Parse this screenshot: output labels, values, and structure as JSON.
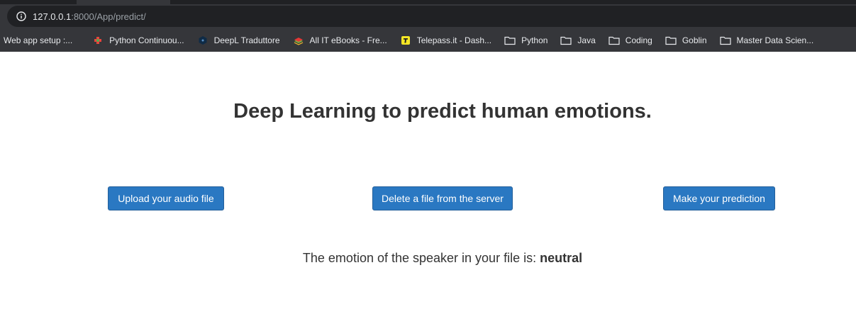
{
  "browser": {
    "url_host": "127.0.0.1",
    "url_rest": ":8000/App/predict/",
    "bookmarks": [
      {
        "label": "Web app setup :...",
        "icon": "none"
      },
      {
        "label": "Python Continuou...",
        "icon": "puzzle-icon",
        "color": "#e8453c"
      },
      {
        "label": "DeepL Traduttore",
        "icon": "deepl-icon",
        "color": "#0f2b46"
      },
      {
        "label": "All IT eBooks - Fre...",
        "icon": "books-icon",
        "color": "#7cb342"
      },
      {
        "label": "Telepass.it - Dash...",
        "icon": "telepass-icon",
        "color": "#f5e625"
      },
      {
        "label": "Python",
        "icon": "folder-icon"
      },
      {
        "label": "Java",
        "icon": "folder-icon"
      },
      {
        "label": "Coding",
        "icon": "folder-icon"
      },
      {
        "label": "Goblin",
        "icon": "folder-icon"
      },
      {
        "label": "Master Data Scien...",
        "icon": "folder-icon"
      }
    ]
  },
  "page": {
    "title": "Deep Learning to predict human emotions.",
    "buttons": {
      "upload": "Upload your audio file",
      "delete": "Delete a file from the server",
      "predict": "Make your prediction"
    },
    "result_prefix": "The emotion of the speaker in your file is: ",
    "result_value": "neutral"
  },
  "colors": {
    "button_bg": "#2a78c2",
    "chrome_bg": "#35363a",
    "text": "#333333"
  }
}
